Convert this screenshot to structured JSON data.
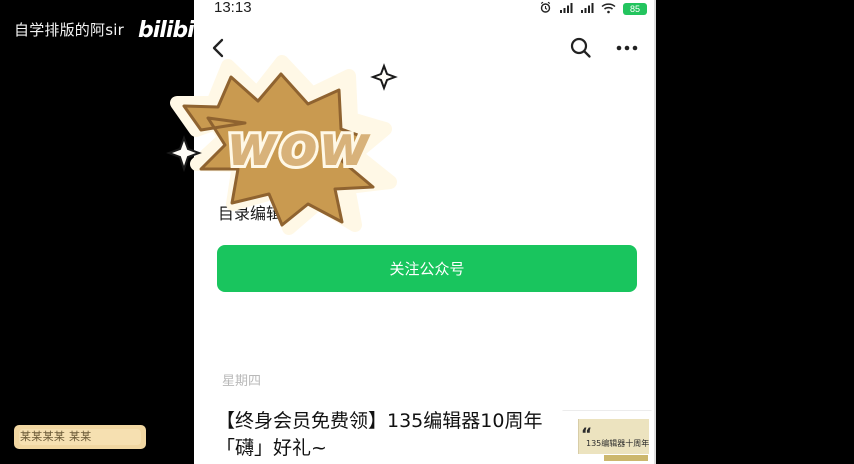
{
  "video": {
    "watermark_text": "自学排版的阿sir",
    "logo_text": "bilibili"
  },
  "status_bar": {
    "time": "13:13",
    "icons": [
      "alarm-icon",
      "signal-icon",
      "signal-icon",
      "wifi-icon",
      "battery-icon"
    ],
    "battery_level": "85"
  },
  "header": {
    "back_icon": "back-chevron-icon",
    "search_icon": "search-icon",
    "more_icon": "more-horizontal-icon"
  },
  "sticker": {
    "text": "wow"
  },
  "account": {
    "name": "目录编辑"
  },
  "actions": {
    "follow_label": "关注公众号"
  },
  "feed": {
    "date_label": "星期四",
    "article": {
      "title": "【终身会员免费领】135编辑器10周年「礴」好礼~",
      "thumbnail_text": "135编辑器十周年"
    }
  },
  "overlay": {
    "pill_text": "某某某某 某某"
  },
  "colors": {
    "screen_background": "#000000",
    "phone_background": "#ffffff",
    "follow_button": "#19c55e",
    "sticker_fill": "#c99a50",
    "sticker_outline": "#fff8e6",
    "date_text": "#b9b9b9"
  }
}
